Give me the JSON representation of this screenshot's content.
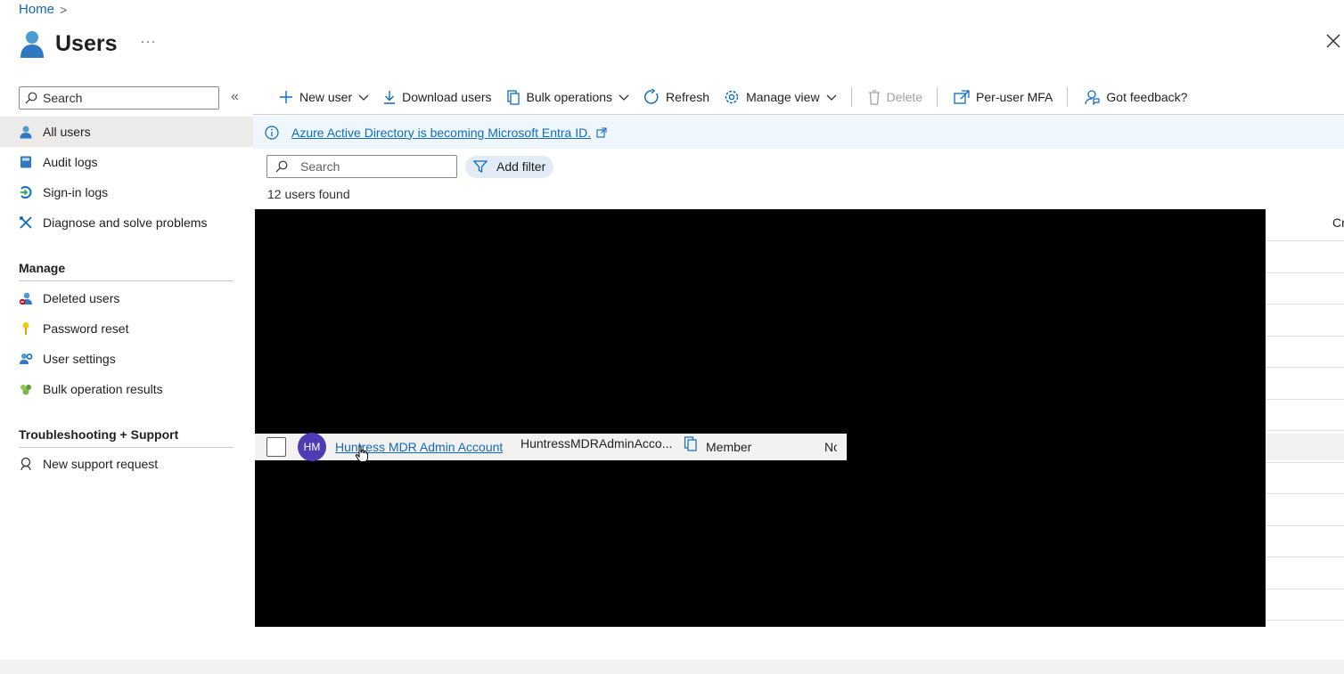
{
  "breadcrumb": {
    "home": "Home",
    "separator": ">"
  },
  "header": {
    "title": "Users",
    "more": "···"
  },
  "sidebar": {
    "search_placeholder": "Search",
    "collapse": "«",
    "items": [
      {
        "label": "All users",
        "icon": "user-icon",
        "active": true
      },
      {
        "label": "Audit logs",
        "icon": "book-icon"
      },
      {
        "label": "Sign-in logs",
        "icon": "signin-icon"
      },
      {
        "label": "Diagnose and solve problems",
        "icon": "wrench-icon"
      }
    ],
    "manage_heading": "Manage",
    "manage_items": [
      {
        "label": "Deleted users",
        "icon": "deleted-user-icon"
      },
      {
        "label": "Password reset",
        "icon": "key-icon"
      },
      {
        "label": "User settings",
        "icon": "user-settings-icon"
      },
      {
        "label": "Bulk operation results",
        "icon": "people-icon"
      }
    ],
    "support_heading": "Troubleshooting + Support",
    "support_items": [
      {
        "label": "New support request",
        "icon": "support-icon"
      }
    ]
  },
  "toolbar": {
    "new_user": "New user",
    "download_users": "Download users",
    "bulk_operations": "Bulk operations",
    "refresh": "Refresh",
    "manage_view": "Manage view",
    "delete": "Delete",
    "per_user_mfa": "Per-user MFA",
    "feedback": "Got feedback?"
  },
  "banner": {
    "text": "Azure Active Directory is becoming Microsoft Entra ID."
  },
  "filter": {
    "search_placeholder": "Search",
    "add_filter": "Add filter"
  },
  "results": {
    "count_text": "12 users found",
    "column_peek": "Cr"
  },
  "row": {
    "initials": "HM",
    "display_name": "Huntress MDR Admin Account",
    "upn": "HuntressMDRAdminAcco...",
    "user_type": "Member",
    "next_col": "No"
  },
  "colors": {
    "accent": "#0f6cbd",
    "avatar": "#4f3bb3",
    "banner_bg": "#eff6fc"
  }
}
